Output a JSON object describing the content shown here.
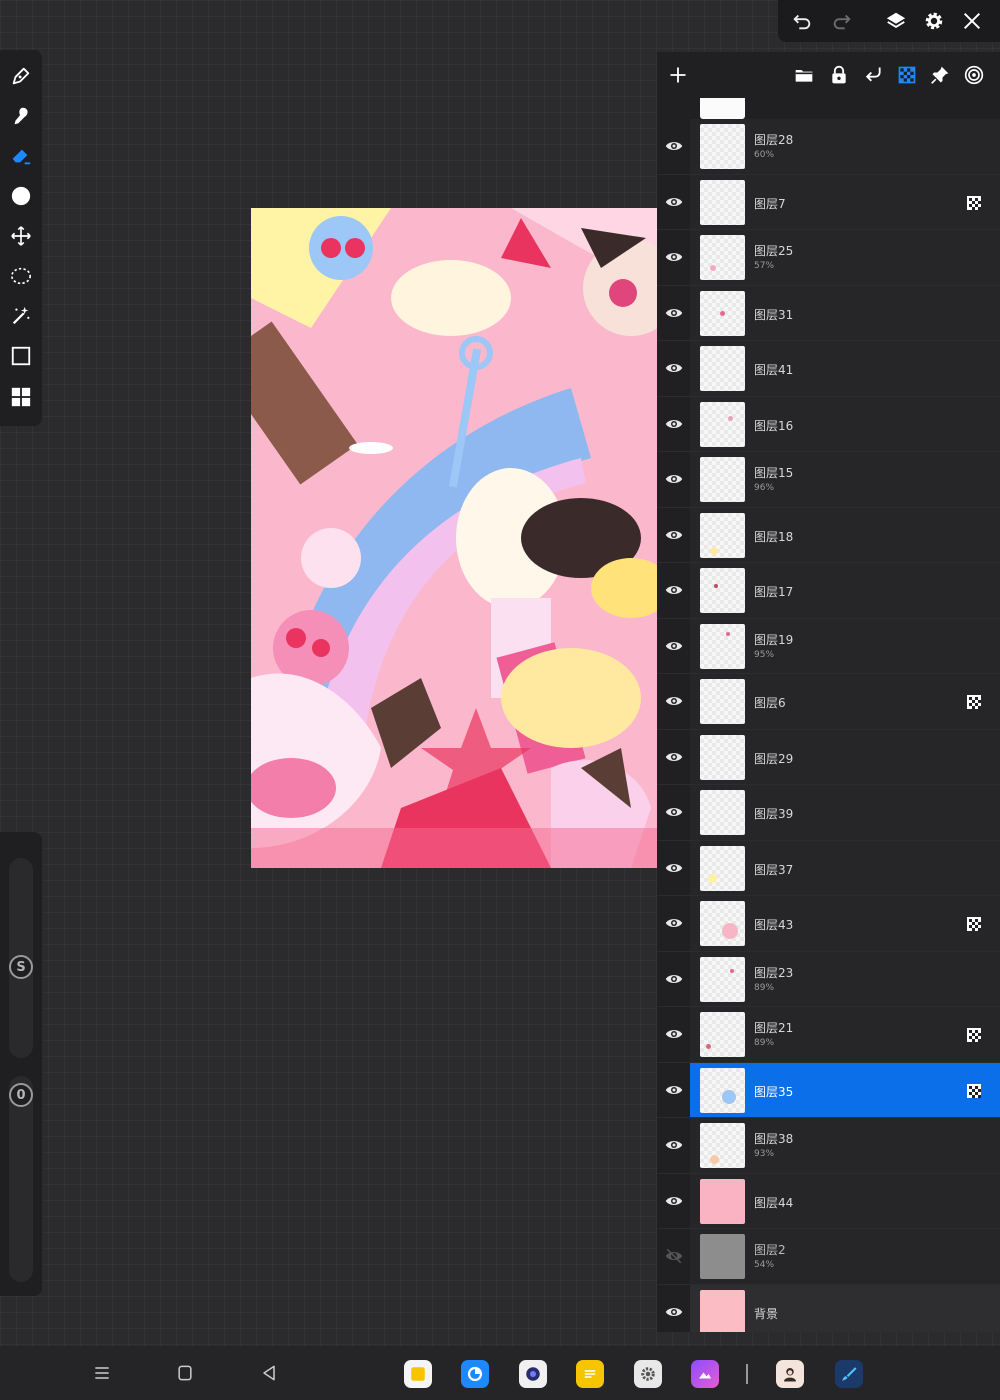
{
  "layers": [
    {
      "name": "图层28",
      "opacity": "60%",
      "visible": true,
      "clipping": false
    },
    {
      "name": "图层7",
      "opacity": "",
      "visible": true,
      "clipping": true
    },
    {
      "name": "图层25",
      "opacity": "57%",
      "visible": true,
      "clipping": false
    },
    {
      "name": "图层31",
      "opacity": "",
      "visible": true,
      "clipping": false
    },
    {
      "name": "图层41",
      "opacity": "",
      "visible": true,
      "clipping": false
    },
    {
      "name": "图层16",
      "opacity": "",
      "visible": true,
      "clipping": false
    },
    {
      "name": "图层15",
      "opacity": "96%",
      "visible": true,
      "clipping": false
    },
    {
      "name": "图层18",
      "opacity": "",
      "visible": true,
      "clipping": false
    },
    {
      "name": "图层17",
      "opacity": "",
      "visible": true,
      "clipping": false
    },
    {
      "name": "图层19",
      "opacity": "95%",
      "visible": true,
      "clipping": false
    },
    {
      "name": "图层6",
      "opacity": "",
      "visible": true,
      "clipping": true
    },
    {
      "name": "图层29",
      "opacity": "",
      "visible": true,
      "clipping": false
    },
    {
      "name": "图层39",
      "opacity": "",
      "visible": true,
      "clipping": false
    },
    {
      "name": "图层37",
      "opacity": "",
      "visible": true,
      "clipping": false
    },
    {
      "name": "图层43",
      "opacity": "",
      "visible": true,
      "clipping": true
    },
    {
      "name": "图层23",
      "opacity": "89%",
      "visible": true,
      "clipping": false
    },
    {
      "name": "图层21",
      "opacity": "89%",
      "visible": true,
      "clipping": true
    },
    {
      "name": "图层35",
      "opacity": "",
      "visible": true,
      "clipping": true,
      "selected": true
    },
    {
      "name": "图层38",
      "opacity": "93%",
      "visible": true,
      "clipping": false
    },
    {
      "name": "图层44",
      "opacity": "",
      "visible": true,
      "clipping": false
    },
    {
      "name": "图层2",
      "opacity": "54%",
      "visible": false,
      "clipping": false
    },
    {
      "name": "背景",
      "opacity": "",
      "visible": true,
      "clipping": false,
      "background": true
    }
  ],
  "side_panel": {
    "size_badge": "S",
    "opacity_badge": "0"
  },
  "colors": {
    "accent": "#0a6fe8",
    "panel": "#202022",
    "canvas_bg": "#2b2b2d",
    "current_color": "#ffffff"
  },
  "icons": {
    "left_toolbar": [
      "pen-icon",
      "smudge-icon",
      "eraser-icon",
      "color-swatch-icon",
      "move-icon",
      "lasso-icon",
      "magic-wand-icon",
      "rectangle-select-icon",
      "gallery-icon"
    ],
    "top_bar": [
      "undo-icon",
      "redo-icon",
      "layers-icon",
      "gear-icon",
      "close-icon"
    ],
    "layer_toolbar": [
      "add-layer-icon",
      "folder-icon",
      "lock-icon",
      "merge-down-icon",
      "clipping-icon",
      "pin-icon",
      "target-icon"
    ],
    "nav": [
      "menu-icon",
      "home-icon",
      "back-icon"
    ],
    "dock": [
      "notes-app-icon",
      "browser-app-icon",
      "camera-app-icon",
      "memo-app-icon",
      "settings-app-icon",
      "gallery-app-icon",
      "avatar-app-icon",
      "paint-app-icon"
    ]
  }
}
